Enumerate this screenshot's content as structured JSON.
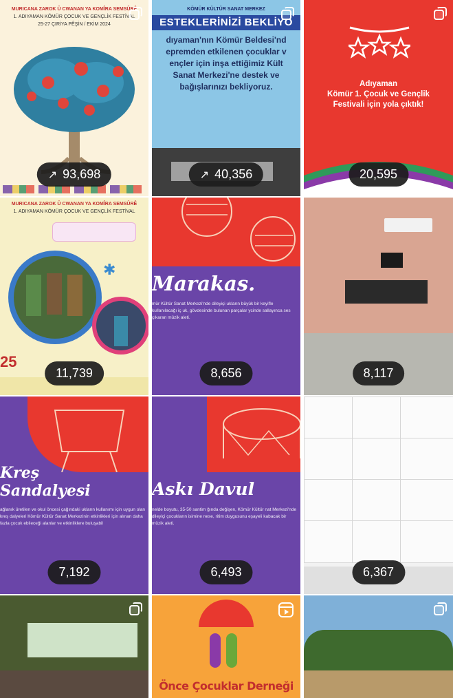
{
  "tiles": [
    {
      "id": "t1",
      "views": "93,698",
      "trend": "↗",
      "header_line1": "MURICANA ZAROK Û CWANAN YA KOMÎRA SEMSÛRÊ",
      "header_line2": "1. ADIYAMAN KÖMÜR ÇOCUK VE GENÇLİK FESTİVAL",
      "header_line3": "25-27 ÇIRİYA PÊŞİN / EKİM 2024",
      "icon": "gallery-icon"
    },
    {
      "id": "t2",
      "views": "40,356",
      "trend": "↗",
      "tagline": "KÖMÜR KÜLTÜR SANAT MERKEZ",
      "banner": "ESTEKLERİNİZİ BEKLİYO",
      "text_lines": [
        "dıyaman'nın Kömür Beldesi'nd",
        "epremden etkilenen çocuklar v",
        "ençler için inşa ettiğimiz Kült",
        "Sanat Merkezi'ne destek ve",
        "bağışlarınızı bekliyoruz."
      ],
      "icon": "gallery-icon"
    },
    {
      "id": "t3",
      "views": "20,595",
      "text_lines": [
        "Adıyaman",
        "Kömür 1. Çocuk ve Gençlik",
        "Festivali için yola çıktık!"
      ],
      "icon": "gallery-icon"
    },
    {
      "id": "t4",
      "views": "11,739",
      "header_line1": "MURICANA ZAROK Û CWANAN YA KOMÎRA SEMSÛRÊ",
      "header_line2": "1. ADIYAMAN KÖMÜR ÇOCUK VE GENÇLİK FESTİVAL",
      "date": "25"
    },
    {
      "id": "t5",
      "views": "8,656",
      "title": "Marakas.",
      "desc": "mür Kültür Sanat Merkezi'nde dileyiçi ukların büyük bir keyifle kullanılacağı iç uk, gövdesinde bulunan parçalar ycinde sallayınca ses çıkaran müzik aleti."
    },
    {
      "id": "t6",
      "views": "8,117"
    },
    {
      "id": "t7",
      "views": "7,192",
      "title_line1": "Kreş",
      "title_line2": "Sandalyesi",
      "desc": "ağlanık üretilen ve okul öncesi çağındaki ukların kullanımı için uygun olan kreş dalyeleri Kömür Kültür Sanat Merkezinin etkinlikleri için alınan daha fazla çocuk ebileceği alanlar ve etkinliklere buluşabil"
    },
    {
      "id": "t8",
      "views": "6,493",
      "title": "Askı Davul",
      "desc": "nelde boyutu, 35-50 santim ğında değişen, Kömür Kültür nat Merkezi'nde dileyiçi çocukların isimine nese, ritim duygusunu eşayeli kabacak bir müzik aleti."
    },
    {
      "id": "t9",
      "views": "6,367"
    },
    {
      "id": "t10",
      "icon": "gallery-icon"
    },
    {
      "id": "t11",
      "org_name": "Önce Çocuklar Derneği",
      "icon": "reel-icon"
    },
    {
      "id": "t12",
      "icon": "gallery-icon"
    }
  ]
}
